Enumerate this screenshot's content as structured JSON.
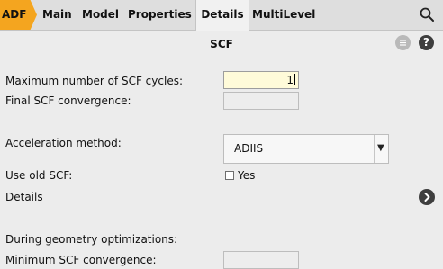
{
  "tabs": [
    {
      "label": "ADF"
    },
    {
      "label": "Main"
    },
    {
      "label": "Model"
    },
    {
      "label": "Properties"
    },
    {
      "label": "Details",
      "active": true
    },
    {
      "label": "MultiLevel"
    }
  ],
  "panel": {
    "title": "SCF",
    "help_label": "?"
  },
  "fields": {
    "max_scf_cycles_label": "Maximum number of SCF cycles:",
    "max_scf_cycles_value": "1",
    "final_convergence_label": "Final SCF convergence:",
    "final_convergence_value": "",
    "acceleration_label": "Acceleration method:",
    "acceleration_value": "ADIIS",
    "use_old_scf_label": "Use old SCF:",
    "use_old_scf_checkbox_label": "Yes",
    "use_old_scf_checked": false,
    "details_label": "Details",
    "geometry_opt_label": "During geometry optimizations:",
    "min_convergence_label": "Minimum SCF convergence:",
    "min_convergence_value": ""
  },
  "colors": {
    "accent": "#f4a51f",
    "active_input": "#fffbd9"
  },
  "icons": [
    "search-icon",
    "menu-icon",
    "help-icon",
    "chevron-right-icon",
    "dropdown-arrow-icon"
  ]
}
